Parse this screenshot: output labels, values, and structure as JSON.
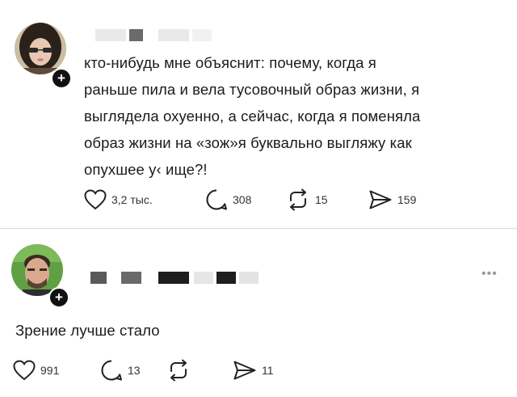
{
  "post1": {
    "text_lines": [
      "кто-нибудь мне объяснит: почему, когда я",
      "раньше пила и вела тусовочный образ жизни, я",
      "выглядела охуенно, а сейчас, когда я поменяла",
      "образ жизни на «зож»я буквально выгляжу как",
      "опухшее у‹ ище?!"
    ],
    "actions": {
      "likes": "3,2 тыс.",
      "replies": "308",
      "reposts": "15",
      "shares": "159"
    }
  },
  "post2": {
    "text": "Зрение лучше стало",
    "actions": {
      "likes": "991",
      "replies": "13",
      "reposts": "",
      "shares": "11"
    },
    "more": "•••"
  },
  "icons": {
    "like": "heart-icon",
    "reply": "speech-bubble-icon",
    "repost": "repost-arrows-icon",
    "share": "send-icon",
    "follow": "plus-icon"
  },
  "colors": {
    "text": "#1b1b1b",
    "icon": "#222222",
    "badge": "#111111",
    "divider": "#dcdcdc",
    "redaction_light": "#e6e6e6",
    "redaction_dark": "#1e1e1e"
  }
}
